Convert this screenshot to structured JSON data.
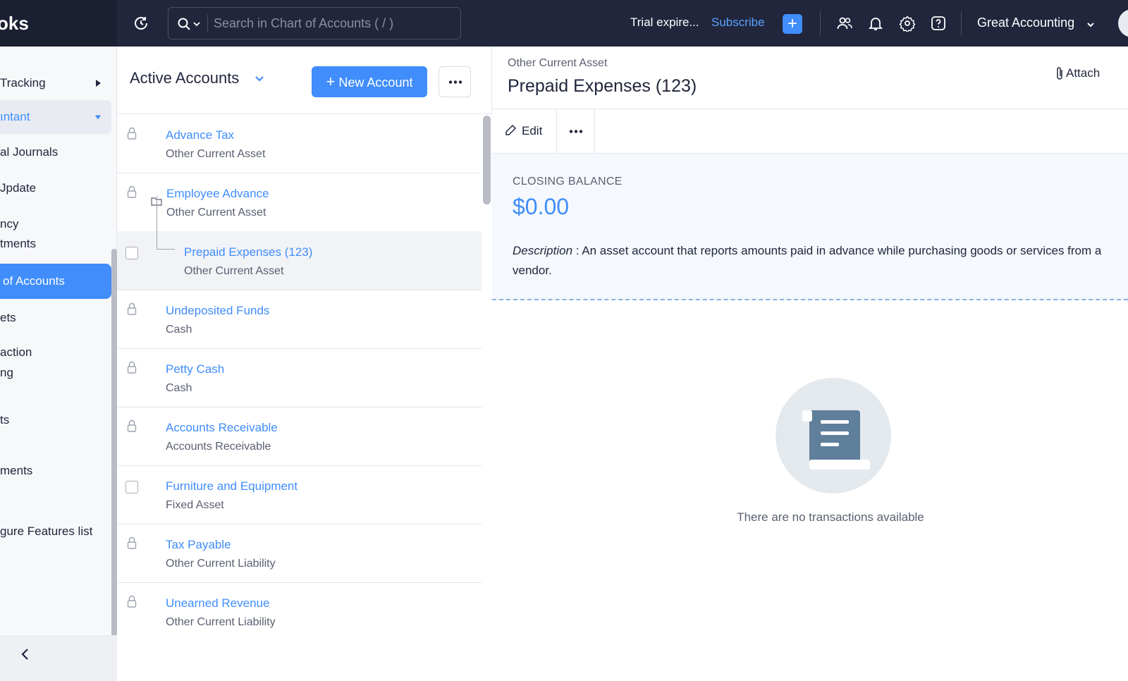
{
  "topbar": {
    "brand": "oks",
    "search_placeholder": "Search in Chart of Accounts ( / )",
    "trial_text": "Trial expire...",
    "subscribe_label": "Subscribe",
    "quick_add_label": "+",
    "org_name": "Great Accounting"
  },
  "sidebar": {
    "items": [
      {
        "label": "Tracking"
      },
      {
        "label": "ıntant"
      },
      {
        "label": "al Journals"
      },
      {
        "label": "Jpdate"
      },
      {
        "label": "ncy",
        "label2": "tments"
      },
      {
        "label": "of Accounts"
      },
      {
        "label": "ets"
      },
      {
        "label": "action",
        "label2": "ng"
      },
      {
        "label": "ts"
      },
      {
        "label": "ments"
      },
      {
        "label": "gure Features list"
      }
    ]
  },
  "list": {
    "view_title": "Active Accounts",
    "new_button": "New Account",
    "rows": [
      {
        "name": "Advance Tax",
        "type": "Other Current Asset"
      },
      {
        "name": "Employee Advance",
        "type": "Other Current Asset"
      },
      {
        "name": "Prepaid Expenses (123)",
        "type": "Other Current Asset"
      },
      {
        "name": "Undeposited Funds",
        "type": "Cash"
      },
      {
        "name": "Petty Cash",
        "type": "Cash"
      },
      {
        "name": "Accounts Receivable",
        "type": "Accounts Receivable"
      },
      {
        "name": "Furniture and Equipment",
        "type": "Fixed Asset"
      },
      {
        "name": "Tax Payable",
        "type": "Other Current Liability"
      },
      {
        "name": "Unearned Revenue",
        "type": "Other Current Liability"
      }
    ]
  },
  "detail": {
    "account_type": "Other Current Asset",
    "title": "Prepaid Expenses (123)",
    "attach_label": "Attach",
    "edit_label": "Edit",
    "closing_balance_label": "CLOSING BALANCE",
    "closing_balance_value": "$0.00",
    "description_label": "Description",
    "description_text": " : An asset account that reports amounts paid in advance while purchasing goods or services from a vendor.",
    "empty_text": "There are no transactions available"
  },
  "colors": {
    "accent": "#408dfb",
    "topbar": "#21263c"
  }
}
